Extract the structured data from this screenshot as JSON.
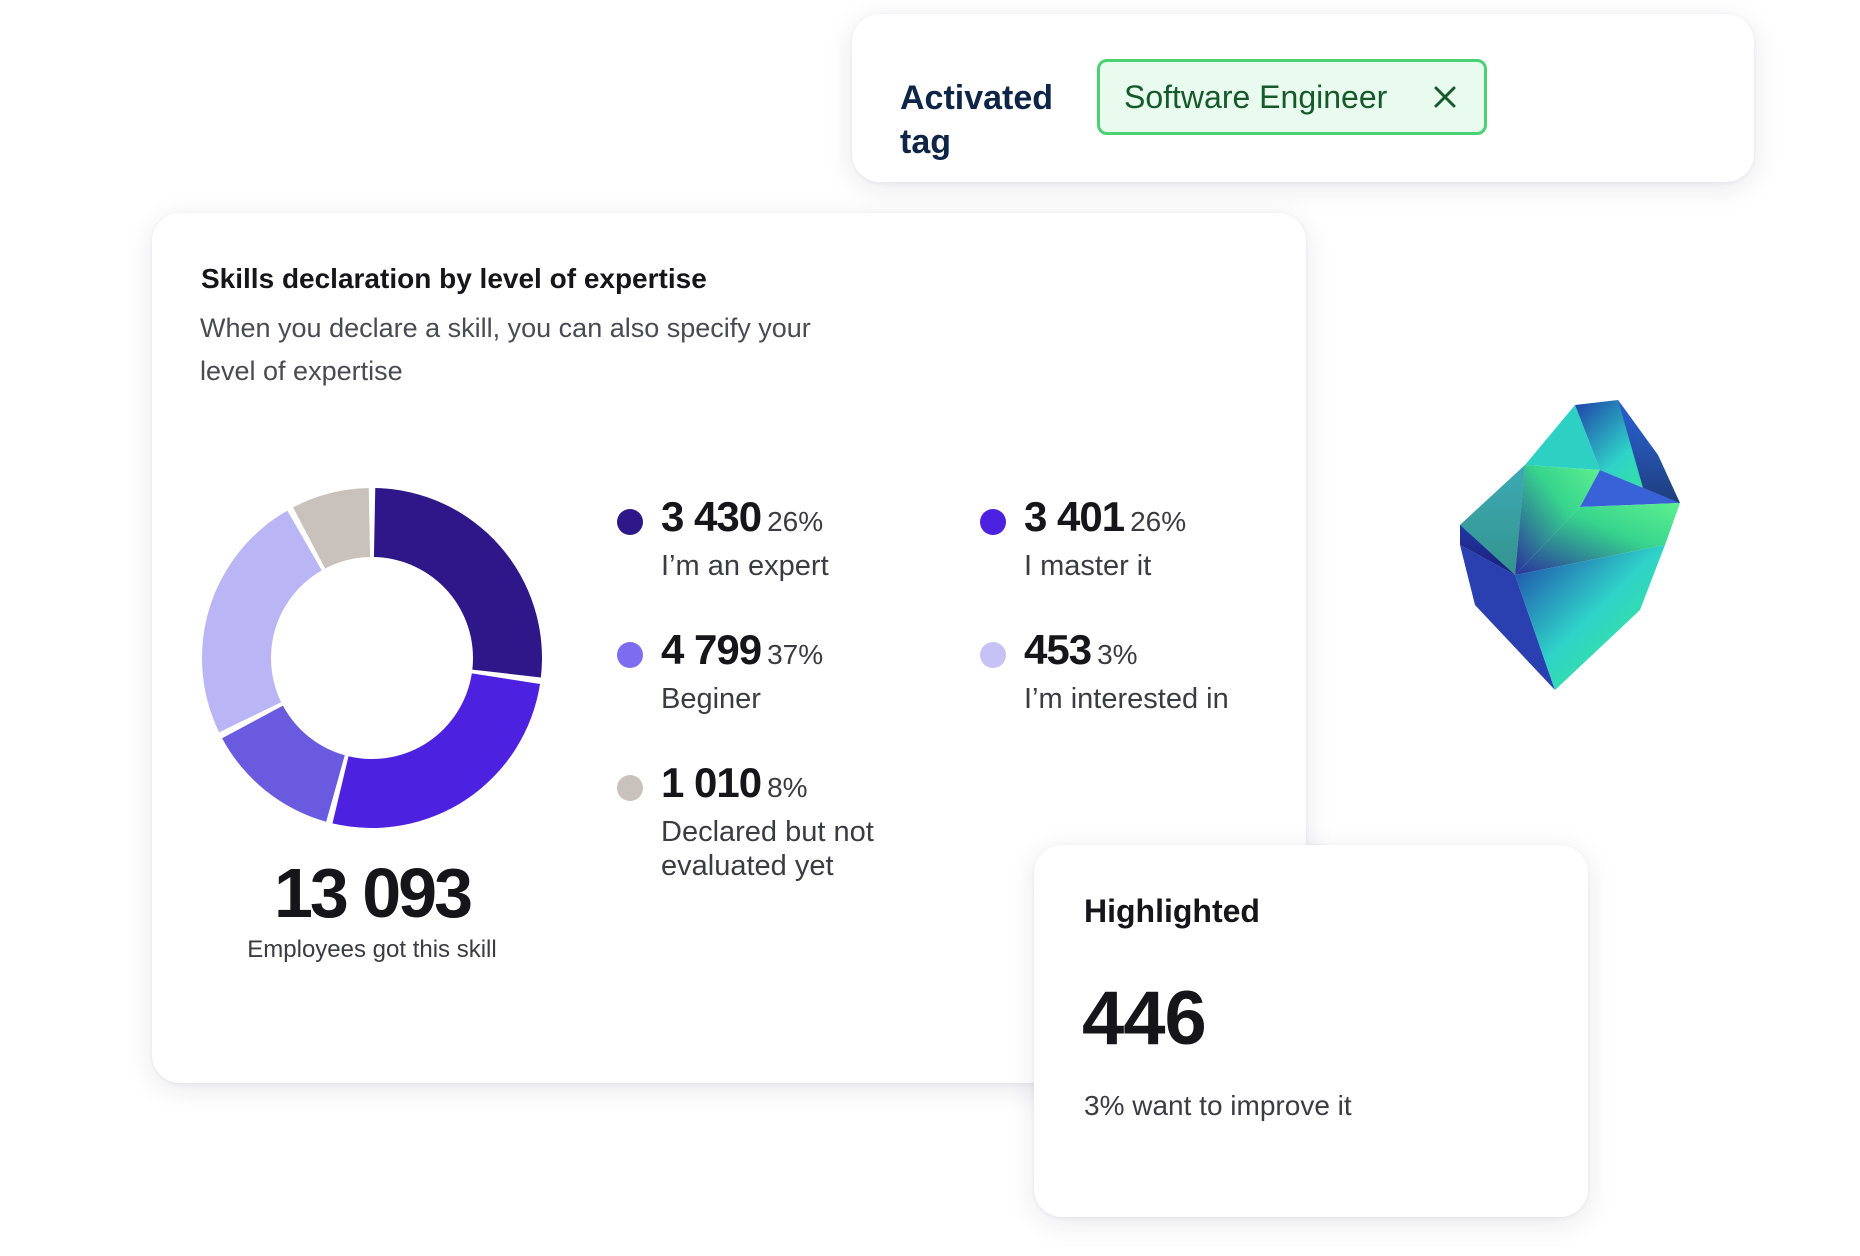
{
  "tag_card": {
    "label": "Activated tag",
    "chip_text": "Software Engineer",
    "chip_close_icon": "close-icon"
  },
  "skills_card": {
    "title": "Skills declaration by level of expertise",
    "subtitle": "When you declare a skill, you can also specify your level of expertise",
    "total_value": "13 093",
    "total_label": "Employees got this skill",
    "legend": [
      {
        "value": "3 430",
        "percent": "26%",
        "label": "I’m an expert",
        "color": "#2e1788"
      },
      {
        "value": "3 401",
        "percent": "26%",
        "label": "I master it",
        "color": "#4d21e0"
      },
      {
        "value": "4 799",
        "percent": "37%",
        "label": "Beginer",
        "color": "#7b6cf0"
      },
      {
        "value": "453",
        "percent": "3%",
        "label": "I’m interested in",
        "color": "#c7c2f5"
      },
      {
        "value": "1 010",
        "percent": "8%",
        "label": "Declared but not evaluated yet",
        "color": "#c9c1bb"
      }
    ]
  },
  "chart_data": {
    "type": "pie",
    "title": "Skills declaration by level of expertise",
    "categories": [
      "I’m an expert",
      "I master it",
      "I’m interested in",
      "Beginer",
      "Declared but not evaluated yet"
    ],
    "values": [
      3430,
      3401,
      1700,
      3100,
      1010
    ],
    "colors": [
      "#2e1788",
      "#4d21e0",
      "#6a5ae0",
      "#bab5f5",
      "#c9c1bb"
    ]
  },
  "highlight_card": {
    "title": "Highlighted",
    "value": "446",
    "subtitle": "3% want to improve it"
  },
  "decor": {
    "gem_icon": "gem-icon"
  }
}
